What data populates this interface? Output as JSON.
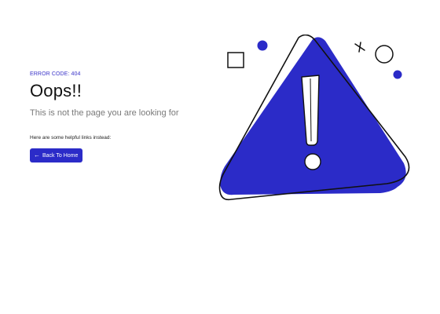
{
  "error": {
    "code_label": "ERROR CODE: 404",
    "title": "Oops!!",
    "subtitle": "This is not the page you are looking for",
    "helpful_text": "Here are some helpful links instead:",
    "back_button_label": "Back To Home",
    "back_icon": "arrow-left-icon"
  },
  "illustration": {
    "name": "warning-triangle-illustration",
    "decorations": [
      "square-icon",
      "dot-icon",
      "cross-icon",
      "circle-icon"
    ]
  },
  "colors": {
    "accent": "#2b2bc8",
    "text": "#111111",
    "muted": "#7a7a7a",
    "background": "#ffffff"
  }
}
